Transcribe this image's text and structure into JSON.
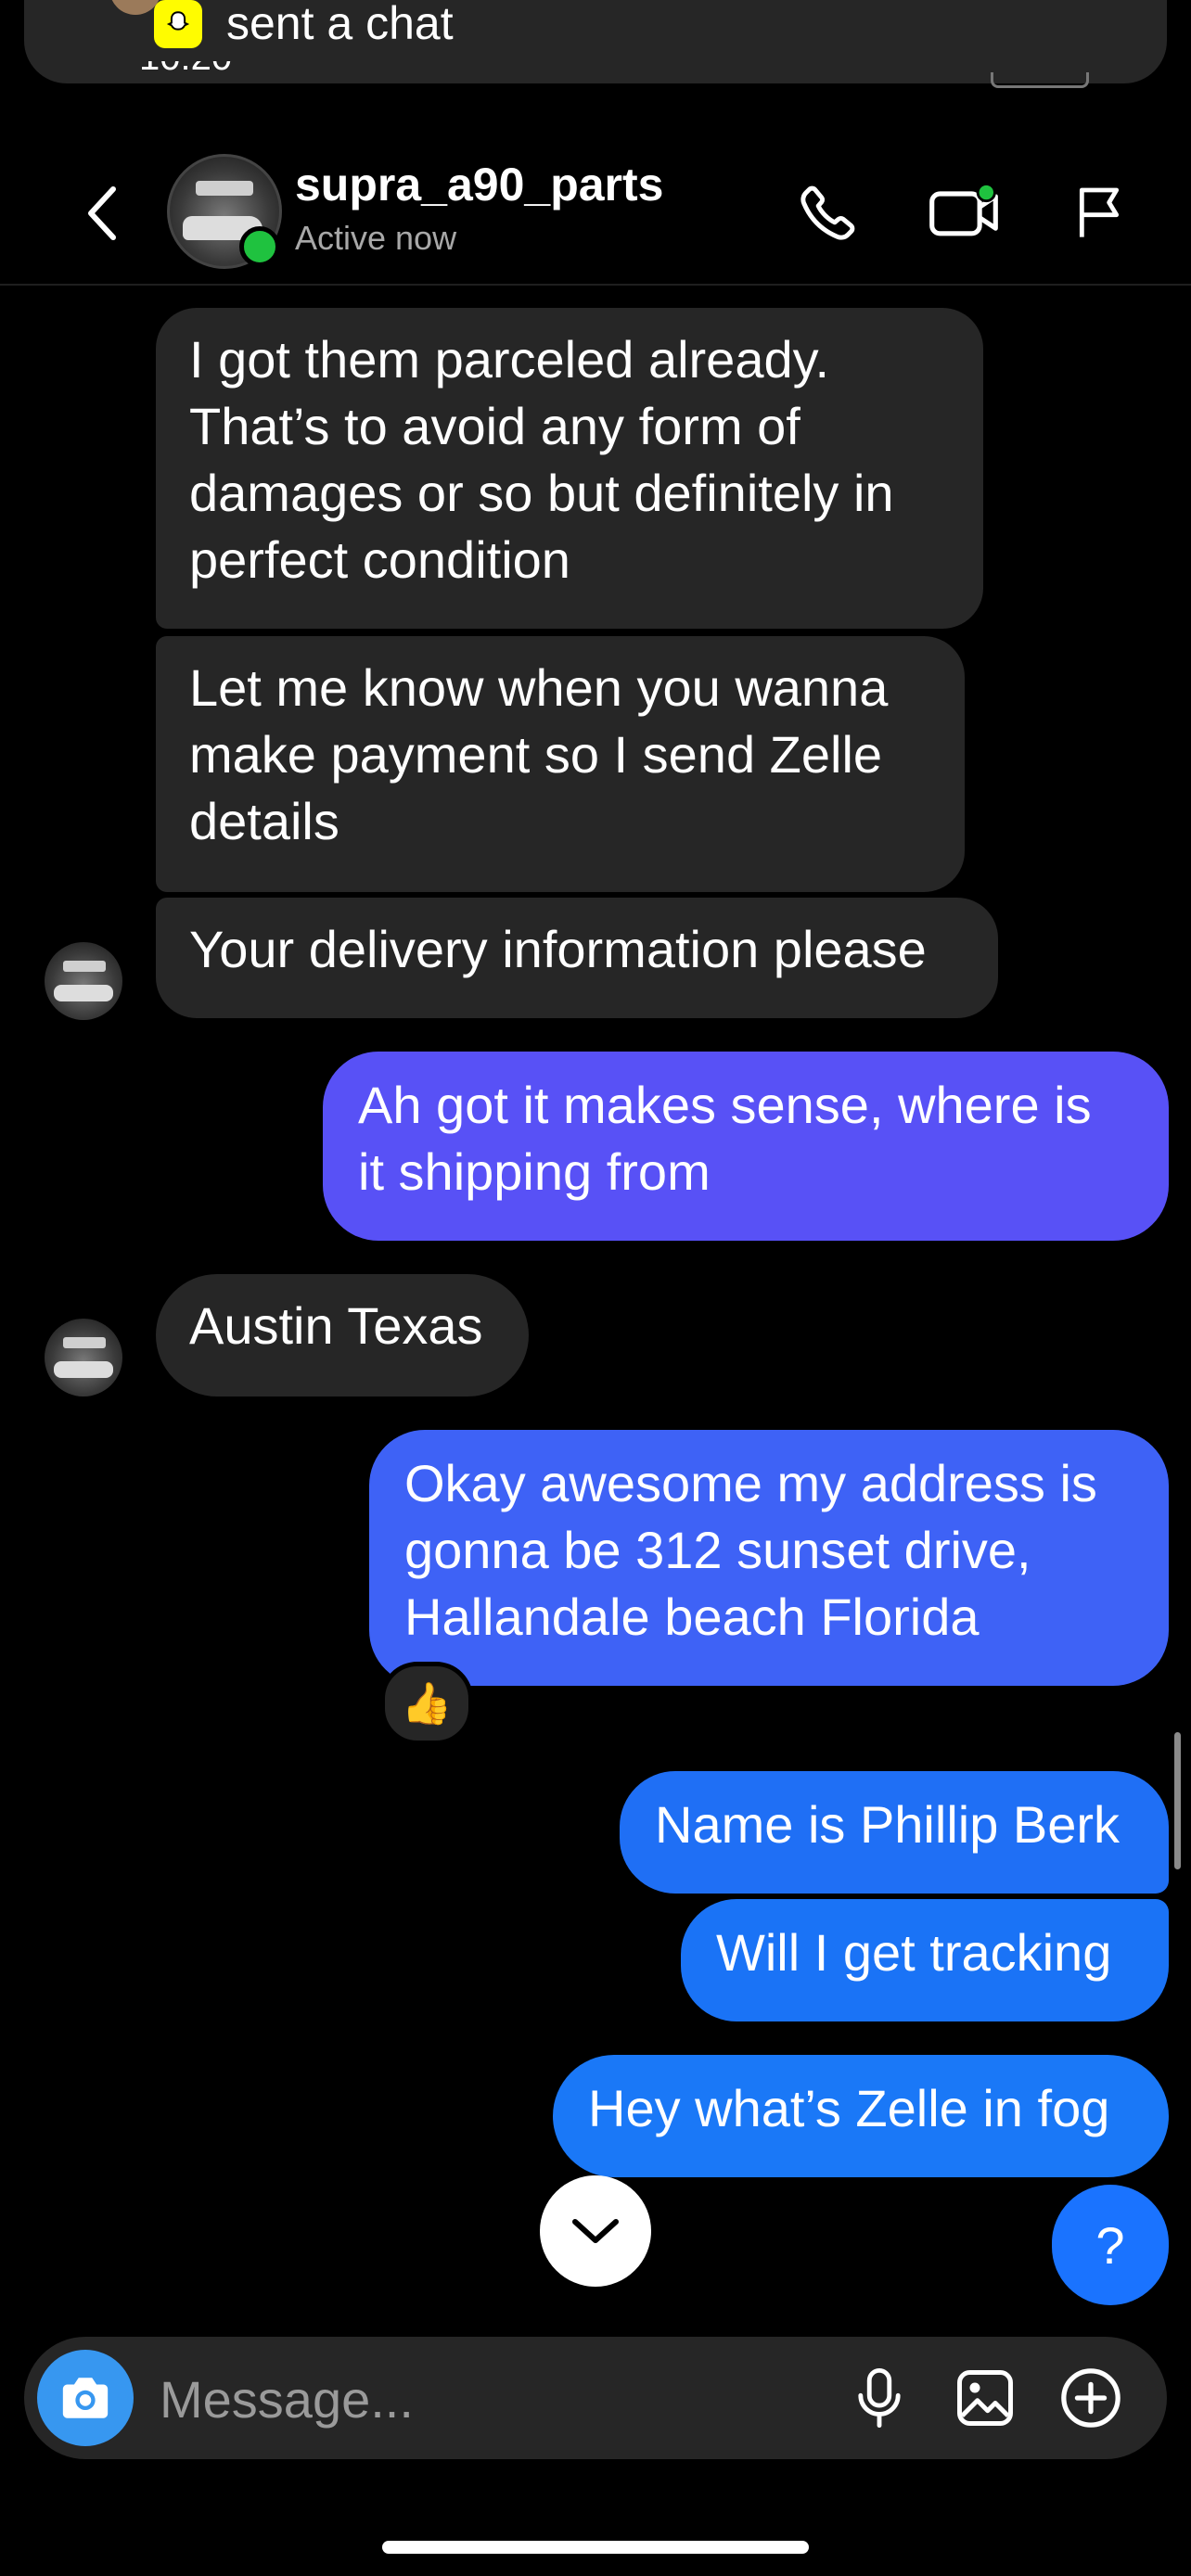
{
  "notification": {
    "text": "sent a chat",
    "status_time_fragment": "10:20"
  },
  "header": {
    "contact_name": "supra_a90_parts",
    "contact_status": "Active now"
  },
  "messages": [
    {
      "direction": "incoming",
      "text": "I got them parceled already.\nThat’s to avoid any form of\ndamages or so but definitely in\nperfect condition"
    },
    {
      "direction": "incoming",
      "text": "Let me know when you wanna\nmake payment so I send Zelle\ndetails"
    },
    {
      "direction": "incoming",
      "text": "Your delivery information please"
    },
    {
      "direction": "outgoing",
      "text": "Ah got it makes sense, where is\nit shipping from",
      "color": "#5851f6"
    },
    {
      "direction": "incoming",
      "text": "Austin Texas"
    },
    {
      "direction": "outgoing",
      "text": "Okay awesome my address is\ngonna be 312 sunset drive,\nHallandale beach Florida",
      "color": "#3e62f6",
      "reaction": "👍"
    },
    {
      "direction": "outgoing",
      "text": "Name is Phillip Berk",
      "color": "#1f6ff5"
    },
    {
      "direction": "outgoing",
      "text": "Will I get tracking",
      "color": "#1a73f6"
    },
    {
      "direction": "outgoing",
      "text": "Hey what’s Zelle in fog",
      "color": "#1a78f7"
    }
  ],
  "help_button_label": "?",
  "composer": {
    "placeholder": "Message..."
  },
  "colors": {
    "background": "#000000",
    "incoming_bubble": "#262626",
    "online_dot": "#1fc23f",
    "camera_button": "#3797f0",
    "help_button": "#1a73ff"
  },
  "icons": {
    "header": [
      "back-chevron-icon",
      "phone-icon",
      "video-call-icon",
      "flag-icon"
    ],
    "composer": [
      "camera-icon",
      "microphone-icon",
      "gallery-icon",
      "add-icon"
    ],
    "other": [
      "snapchat-icon",
      "chevron-down-icon",
      "thumbs-up-icon"
    ]
  }
}
